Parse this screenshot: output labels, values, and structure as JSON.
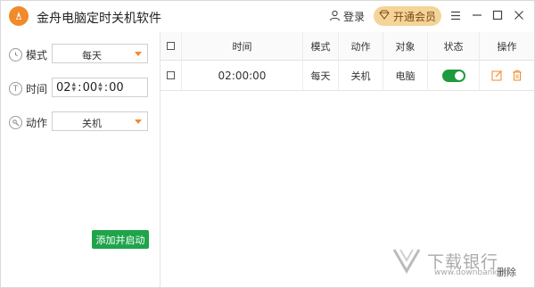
{
  "app": {
    "title": "金舟电脑定时关机软件"
  },
  "header": {
    "login_label": "登录",
    "vip_label": "开通会员",
    "vip_bg_color": "#f5d49a"
  },
  "left_panel": {
    "mode_label": "模式",
    "mode_value": "每天",
    "time_label": "时间",
    "time": {
      "hour": "02",
      "minute": "00",
      "second": "00",
      "sep": ":"
    },
    "action_label": "动作",
    "action_value": "关机",
    "add_button_label": "添加并启动",
    "accent_color": "#f08a2a",
    "button_color": "#1ea44a"
  },
  "table": {
    "headers": [
      "时间",
      "模式",
      "动作",
      "对象",
      "状态",
      "操作"
    ],
    "rows": [
      {
        "time": "02:00:00",
        "mode": "每天",
        "action": "关机",
        "target": "电脑",
        "status_on": true
      }
    ],
    "toggle_color": "#1e9a3e"
  },
  "footer": {
    "delete_label": "删除"
  },
  "watermark": {
    "text": "下载银行",
    "sub": "www.downbank.cn"
  }
}
